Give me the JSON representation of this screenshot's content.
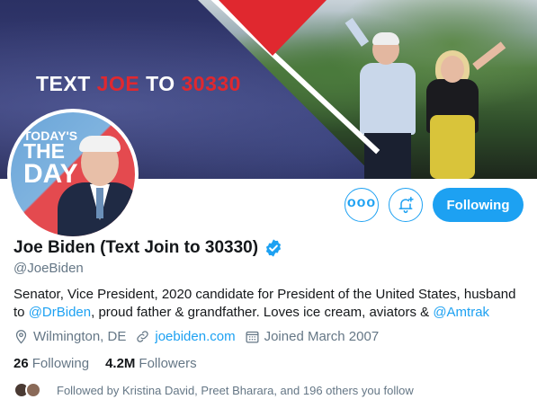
{
  "banner": {
    "text_prefix": "TEXT ",
    "text_highlight": "JOE",
    "text_middle": " TO ",
    "text_number": "30330"
  },
  "avatar": {
    "line1": "TODAY'S",
    "line2": "THE",
    "line3": "DAY"
  },
  "actions": {
    "more_label": "ooo",
    "following_label": "Following"
  },
  "profile": {
    "display_name": "Joe Biden (Text Join to 30330)",
    "handle": "@JoeBiden",
    "bio_part1": "Senator, Vice President, 2020 candidate for President of the United States, husband to ",
    "bio_mention1": "@DrBiden",
    "bio_part2": ", proud father & grandfather. Loves ice cream, aviators & ",
    "bio_mention2": "@Amtrak",
    "location": "Wilmington, DE",
    "website": "joebiden.com",
    "joined": "Joined March 2007"
  },
  "stats": {
    "following_count": "26",
    "following_label": "Following",
    "followers_count": "4.2M",
    "followers_label": "Followers"
  },
  "followed_by": "Followed by Kristina David, Preet Bharara, and 196 others you follow",
  "colors": {
    "accent": "#1da1f2",
    "banner_red": "#e0282f",
    "muted_text": "#657786"
  }
}
